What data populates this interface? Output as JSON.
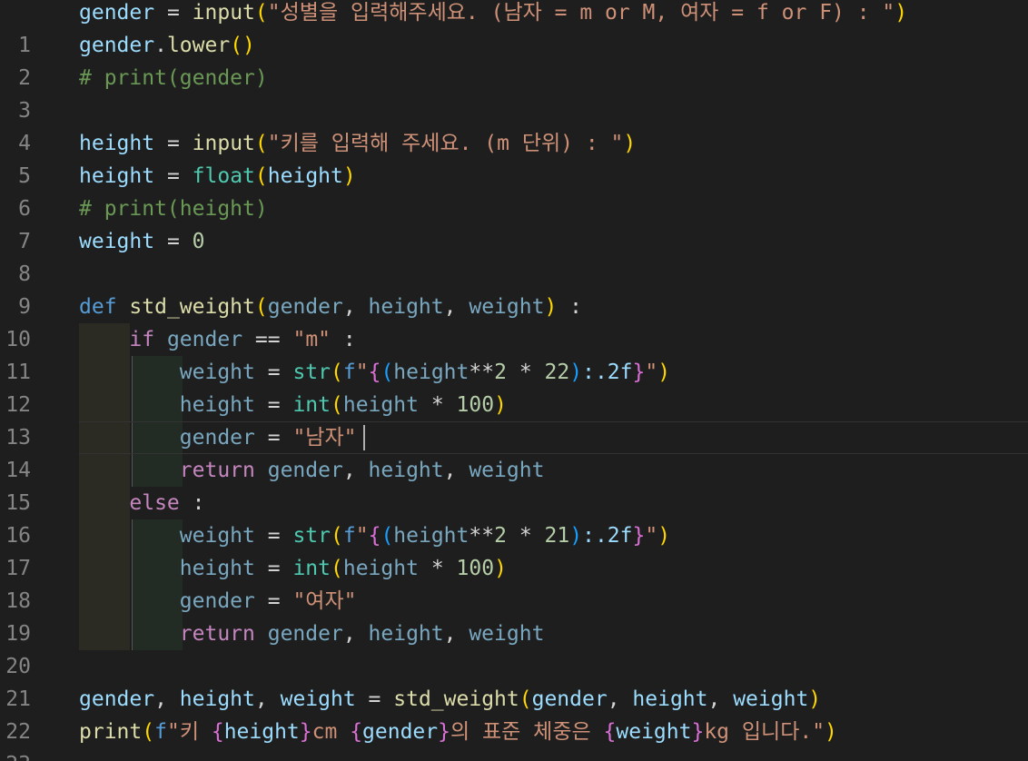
{
  "editor": {
    "language": "python",
    "theme_colors": {
      "background": "#1e1e1e",
      "line_number": "#858585",
      "variable": "#9cdcfe",
      "function": "#dcdcaa",
      "builtin_type": "#4ec9b0",
      "keyword_def": "#569cd6",
      "keyword_control": "#c586c0",
      "string": "#ce9178",
      "number": "#b5cea8",
      "comment": "#6a9955",
      "bracket_level1": "#ffd700",
      "bracket_level2": "#da70d6",
      "bracket_level3": "#179fff"
    },
    "cursor_line": 14,
    "lines": [
      {
        "n": "1",
        "text": "gender = input(\"성별을 입력해주세요. (남자 = m or M, 여자 = f or F) : \")"
      },
      {
        "n": "2",
        "text": "gender.lower()"
      },
      {
        "n": "3",
        "text": "# print(gender)"
      },
      {
        "n": "4",
        "text": ""
      },
      {
        "n": "5",
        "text": "height = input(\"키를 입력해 주세요. (m 단위) : \")"
      },
      {
        "n": "6",
        "text": "height = float(height)"
      },
      {
        "n": "7",
        "text": "# print(height)"
      },
      {
        "n": "8",
        "text": "weight = 0"
      },
      {
        "n": "9",
        "text": ""
      },
      {
        "n": "10",
        "text": "def std_weight(gender, height, weight) :"
      },
      {
        "n": "11",
        "text": "    if gender == \"m\" :"
      },
      {
        "n": "12",
        "text": "        weight = str(f\"{(height**2 * 22):.2f}\")"
      },
      {
        "n": "13",
        "text": "        height = int(height * 100)"
      },
      {
        "n": "14",
        "text": "        gender = \"남자\""
      },
      {
        "n": "15",
        "text": "        return gender, height, weight"
      },
      {
        "n": "16",
        "text": "    else :"
      },
      {
        "n": "17",
        "text": "        weight = str(f\"{(height**2 * 21):.2f}\")"
      },
      {
        "n": "18",
        "text": "        height = int(height * 100)"
      },
      {
        "n": "19",
        "text": "        gender = \"여자\""
      },
      {
        "n": "20",
        "text": "        return gender, height, weight"
      },
      {
        "n": "21",
        "text": ""
      },
      {
        "n": "22",
        "text": "gender, height, weight = std_weight(gender, height, weight)"
      },
      {
        "n": "23",
        "text": "print(f\"키 {height}cm {gender}의 표준 체중은 {weight}kg 입니다.\")"
      }
    ]
  }
}
